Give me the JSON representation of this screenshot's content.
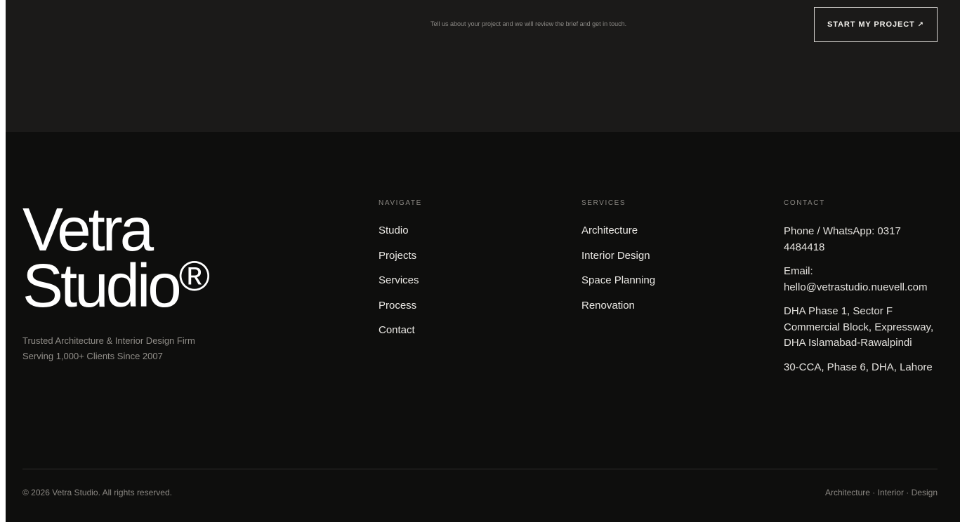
{
  "cta": {
    "text": "Tell us about your project and we will review the brief and get in touch.",
    "button_label": "START MY PROJECT",
    "button_arrow": "↗"
  },
  "brand": {
    "logo_line1": "Vetra",
    "logo_line2": "Studio",
    "logo_mark": "®",
    "tagline_line1": "Trusted Architecture & Interior Design Firm",
    "tagline_line2": "Serving 1,000+ Clients Since 2007"
  },
  "navigate": {
    "heading": "NAVIGATE",
    "items": [
      "Studio",
      "Projects",
      "Services",
      "Process",
      "Contact"
    ]
  },
  "services": {
    "heading": "SERVICES",
    "items": [
      "Architecture",
      "Interior Design",
      "Space Planning",
      "Renovation"
    ]
  },
  "contact": {
    "heading": "CONTACT",
    "phone_line1": "Phone / WhatsApp: 0317",
    "phone_line2": "4484418",
    "email_label": "Email:",
    "email_value": "hello@vetrastudio.nuevell.com",
    "address1_line1": "DHA Phase 1, Sector F",
    "address1_line2": "Commercial Block, Expressway,",
    "address1_line3": "DHA Islamabad-Rawalpindi",
    "address2": "30-CCA, Phase 6, DHA, Lahore"
  },
  "bottom": {
    "copyright": "© 2026 Vetra Studio. All rights reserved.",
    "disciplines": "Architecture · Interior · Design"
  },
  "colors": {
    "cta_band": "#1b1a19",
    "footer_bg": "#0e0e0d",
    "text_primary": "#e9e7e3",
    "text_muted": "#8a8782"
  }
}
